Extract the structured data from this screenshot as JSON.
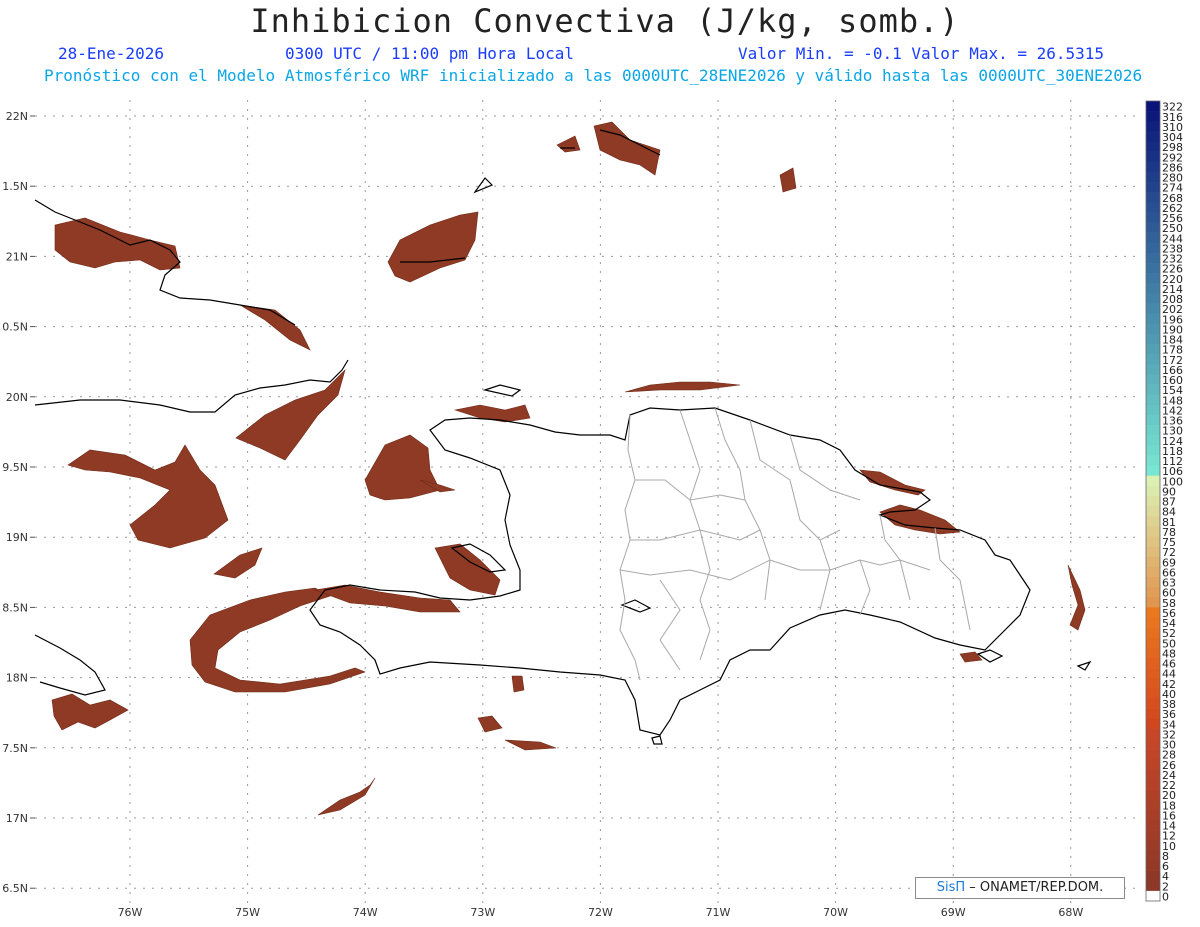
{
  "header": {
    "title": "Inhibicion Convectiva (J/kg, somb.)",
    "date": "28-Ene-2026",
    "time": "0300 UTC / 11:00 pm Hora Local",
    "minmax": "Valor Min. = -0.1  Valor Max. = 26.5315",
    "subtitle": "Pronóstico con el Modelo Atmosférico WRF inicializado a las 0000UTC_28ENE2026 y válido hasta las  0000UTC_30ENE2026"
  },
  "axes": {
    "lat_labels": [
      "22N",
      "1.5N",
      "21N",
      "0.5N",
      "20N",
      "9.5N",
      "19N",
      "8.5N",
      "18N",
      "7.5N",
      "17N",
      "6.5N"
    ],
    "lon_labels": [
      "76W",
      "75W",
      "74W",
      "73W",
      "72W",
      "71W",
      "70W",
      "69W",
      "68W"
    ]
  },
  "colorbar": {
    "labels": [
      "322",
      "316",
      "310",
      "304",
      "298",
      "292",
      "286",
      "280",
      "274",
      "268",
      "262",
      "256",
      "250",
      "244",
      "238",
      "232",
      "226",
      "220",
      "214",
      "208",
      "202",
      "196",
      "190",
      "184",
      "178",
      "172",
      "166",
      "160",
      "154",
      "148",
      "142",
      "136",
      "130",
      "124",
      "118",
      "112",
      "106",
      "100",
      "90",
      "87",
      "84",
      "81",
      "78",
      "75",
      "72",
      "69",
      "66",
      "63",
      "60",
      "58",
      "56",
      "54",
      "52",
      "50",
      "48",
      "46",
      "44",
      "42",
      "40",
      "38",
      "36",
      "34",
      "32",
      "30",
      "28",
      "26",
      "24",
      "22",
      "20",
      "18",
      "16",
      "14",
      "12",
      "10",
      "8",
      "6",
      "4",
      "2",
      "0"
    ]
  },
  "credit": {
    "logo": "SisΠ",
    "text": " – ONAMET/REP.DOM."
  },
  "colors": {
    "field": "#8e3a24",
    "coast": "#000000",
    "provinces": "#a8a8a8",
    "grid": "#9a9a9a"
  }
}
